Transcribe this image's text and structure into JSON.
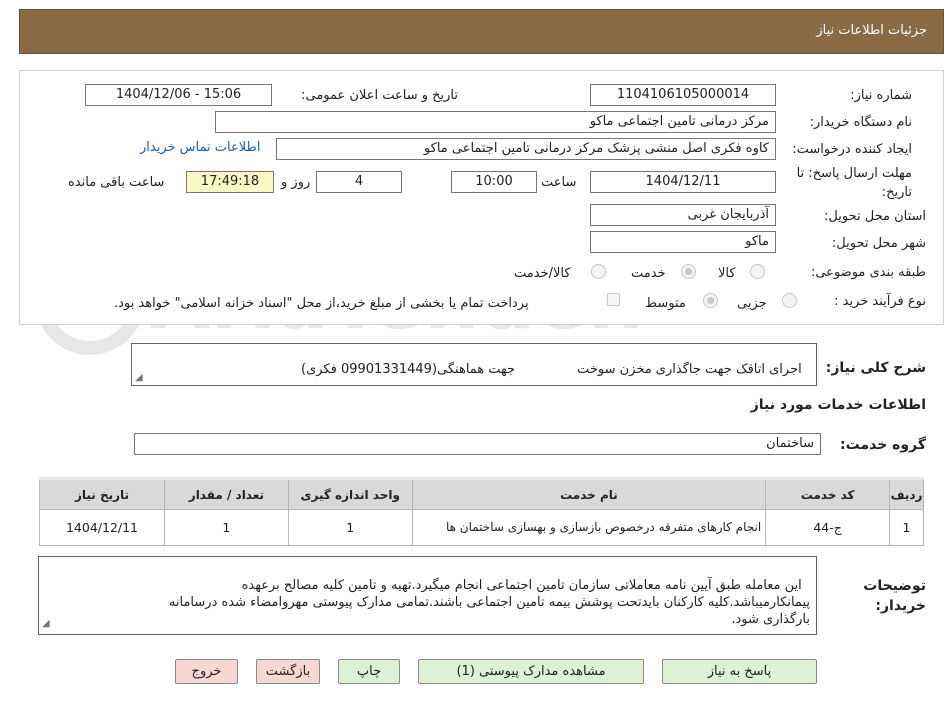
{
  "header": {
    "title": "جزئیات اطلاعات نیاز"
  },
  "form": {
    "need_number_label": "شماره نیاز:",
    "need_number": "1104106105000014",
    "announce_label": "تاریخ و ساعت اعلان عمومی:",
    "announce_value": "1404/12/06 - 15:06",
    "buyer_label": "نام دستگاه خریدار:",
    "buyer_value": "مرکز درمانی تامین اجتماعی ماکو",
    "creator_label": "ایجاد کننده درخواست:",
    "creator_value": "کاوه فکری اصل منشی پزشک مرکز درمانی تامین اجتماعی ماکو",
    "contact_link": "اطلاعات تماس خریدار",
    "deadline_label_1": "مهلت ارسال پاسخ: تا",
    "deadline_label_2": "تاریخ:",
    "deadline_date": "1404/12/11",
    "time_label": "ساعت",
    "deadline_time": "10:00",
    "days_value": "4",
    "days_label": "روز و",
    "remaining_time": "17:49:18",
    "remaining_label": "ساعت باقی مانده",
    "province_label": "استان محل تحویل:",
    "province_value": "آذربایجان غربی",
    "city_label": "شهر محل تحویل:",
    "city_value": "ماکو",
    "category_label": "طبقه بندی موضوعی:",
    "category_options": [
      "کالا",
      "خدمت",
      "کالا/خدمت"
    ],
    "category_selected": "خدمت",
    "process_label": "نوع فرآیند خرید :",
    "process_options": [
      "جزیی",
      "متوسط"
    ],
    "process_selected": "متوسط",
    "payment_note": "پرداخت تمام یا بخشی از مبلغ خرید،از محل \"اسناد خزانه اسلامی\" خواهد بود."
  },
  "description": {
    "label": "شرح کلی نیاز:",
    "value": "اجرای اتاقک جهت جاگذاری مخزن سوخت               جهت هماهنگی(09901331449 فکری)"
  },
  "services": {
    "section_title": "اطلاعات خدمات مورد نیاز",
    "group_label": "گروه خدمت:",
    "group_value": "ساختمان",
    "columns": [
      "ردیف",
      "کد خدمت",
      "نام خدمت",
      "واحد اندازه گیری",
      "تعداد / مقدار",
      "تاریخ نیاز"
    ],
    "rows": [
      [
        "1",
        "ج-44",
        "انجام کارهای متفرقه درخصوص بازسازی و بهسازی ساختمان ها",
        "1",
        "1",
        "1404/12/11"
      ]
    ]
  },
  "buyer_notes": {
    "label_1": "توضیحات",
    "label_2": "خریدار:",
    "value": "این معامله طبق آیین نامه معاملاتی سازمان تامین اجتماعی انجام میگیرد.تهیه و تامین کلیه مصالح برعهده\nپیمانکارمیباشد.کلیه کارکنان بایدتحت پوشش بیمه تامین اجتماعی باشند.تمامی مدارک پیوستی مهروامضاء شده درسامانه\nبارگذاری شود."
  },
  "buttons": {
    "respond": "پاسخ به نیاز",
    "attachments": "مشاهده مدارک پیوستی (1)",
    "print": "چاپ",
    "back": "بازگشت",
    "exit": "خروج"
  },
  "watermark": {
    "text": "AriaTender.neT"
  }
}
